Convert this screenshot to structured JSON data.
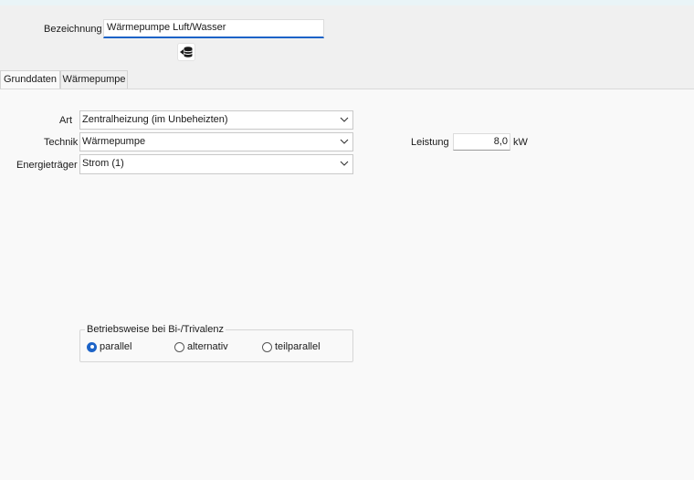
{
  "header": {
    "bezeichnung_label": "Bezeichnung",
    "bezeichnung_value": "Wärmepumpe Luft/Wasser",
    "db_icon": "database-arrow-icon"
  },
  "tabs": [
    {
      "label": "Grunddaten",
      "active": true
    },
    {
      "label": "Wärmepumpe",
      "active": false
    }
  ],
  "form": {
    "art_label": "Art",
    "art_value": "Zentralheizung (im Unbeheizten)",
    "technik_label": "Technik",
    "technik_value": "Wärmepumpe",
    "energietraeger_label": "Energieträger",
    "energietraeger_value": "Strom (1)",
    "leistung_label": "Leistung",
    "leistung_value": "8,0",
    "leistung_unit": "kW"
  },
  "betriebsweise": {
    "title": "Betriebsweise bei Bi-/Trivalenz",
    "options": [
      {
        "label": "parallel",
        "selected": true
      },
      {
        "label": "alternativ",
        "selected": false
      },
      {
        "label": "teilparallel",
        "selected": false
      }
    ]
  },
  "colors": {
    "accent": "#1c63c7",
    "background": "#f9f9f9",
    "header_bg": "#f0f0f0"
  }
}
